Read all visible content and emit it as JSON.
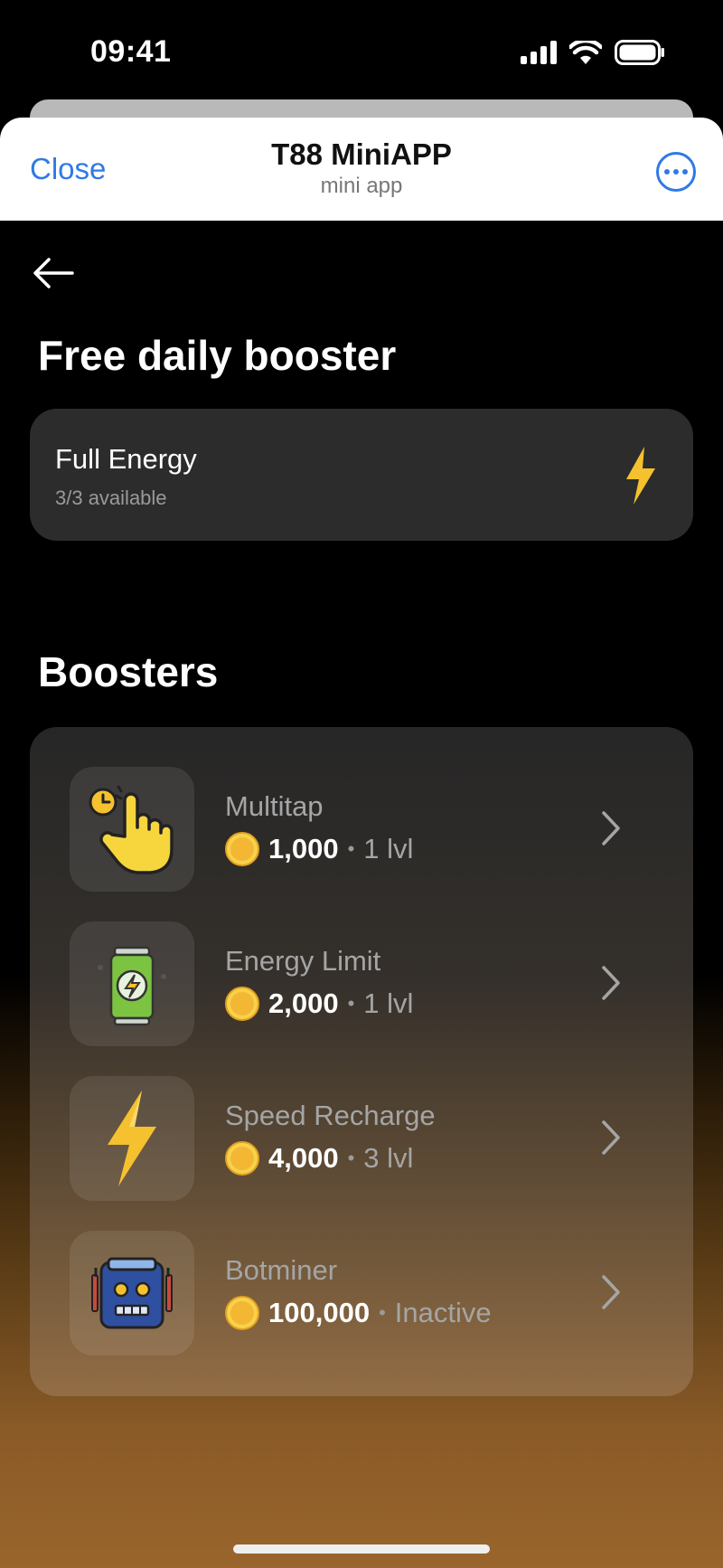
{
  "status_bar": {
    "time": "09:41"
  },
  "header": {
    "close_label": "Close",
    "title": "T88 MiniAPP",
    "subtitle": "mini app"
  },
  "free_section": {
    "title": "Free daily booster",
    "card": {
      "name": "Full Energy",
      "availability": "3/3 available"
    }
  },
  "boosters_section": {
    "title": "Boosters",
    "items": [
      {
        "name": "Multitap",
        "price": "1,000",
        "level": "1 lvl",
        "icon": "tap-hand-icon"
      },
      {
        "name": "Energy Limit",
        "price": "2,000",
        "level": "1 lvl",
        "icon": "energy-can-icon"
      },
      {
        "name": "Speed Recharge",
        "price": "4,000",
        "level": "3 lvl",
        "icon": "lightning-icon"
      },
      {
        "name": "Botminer",
        "price": "100,000",
        "level": "Inactive",
        "icon": "robot-icon"
      }
    ]
  },
  "colors": {
    "accent": "#2f7ae5",
    "coin": "#f3b733",
    "bolt": "#f5c12e"
  }
}
